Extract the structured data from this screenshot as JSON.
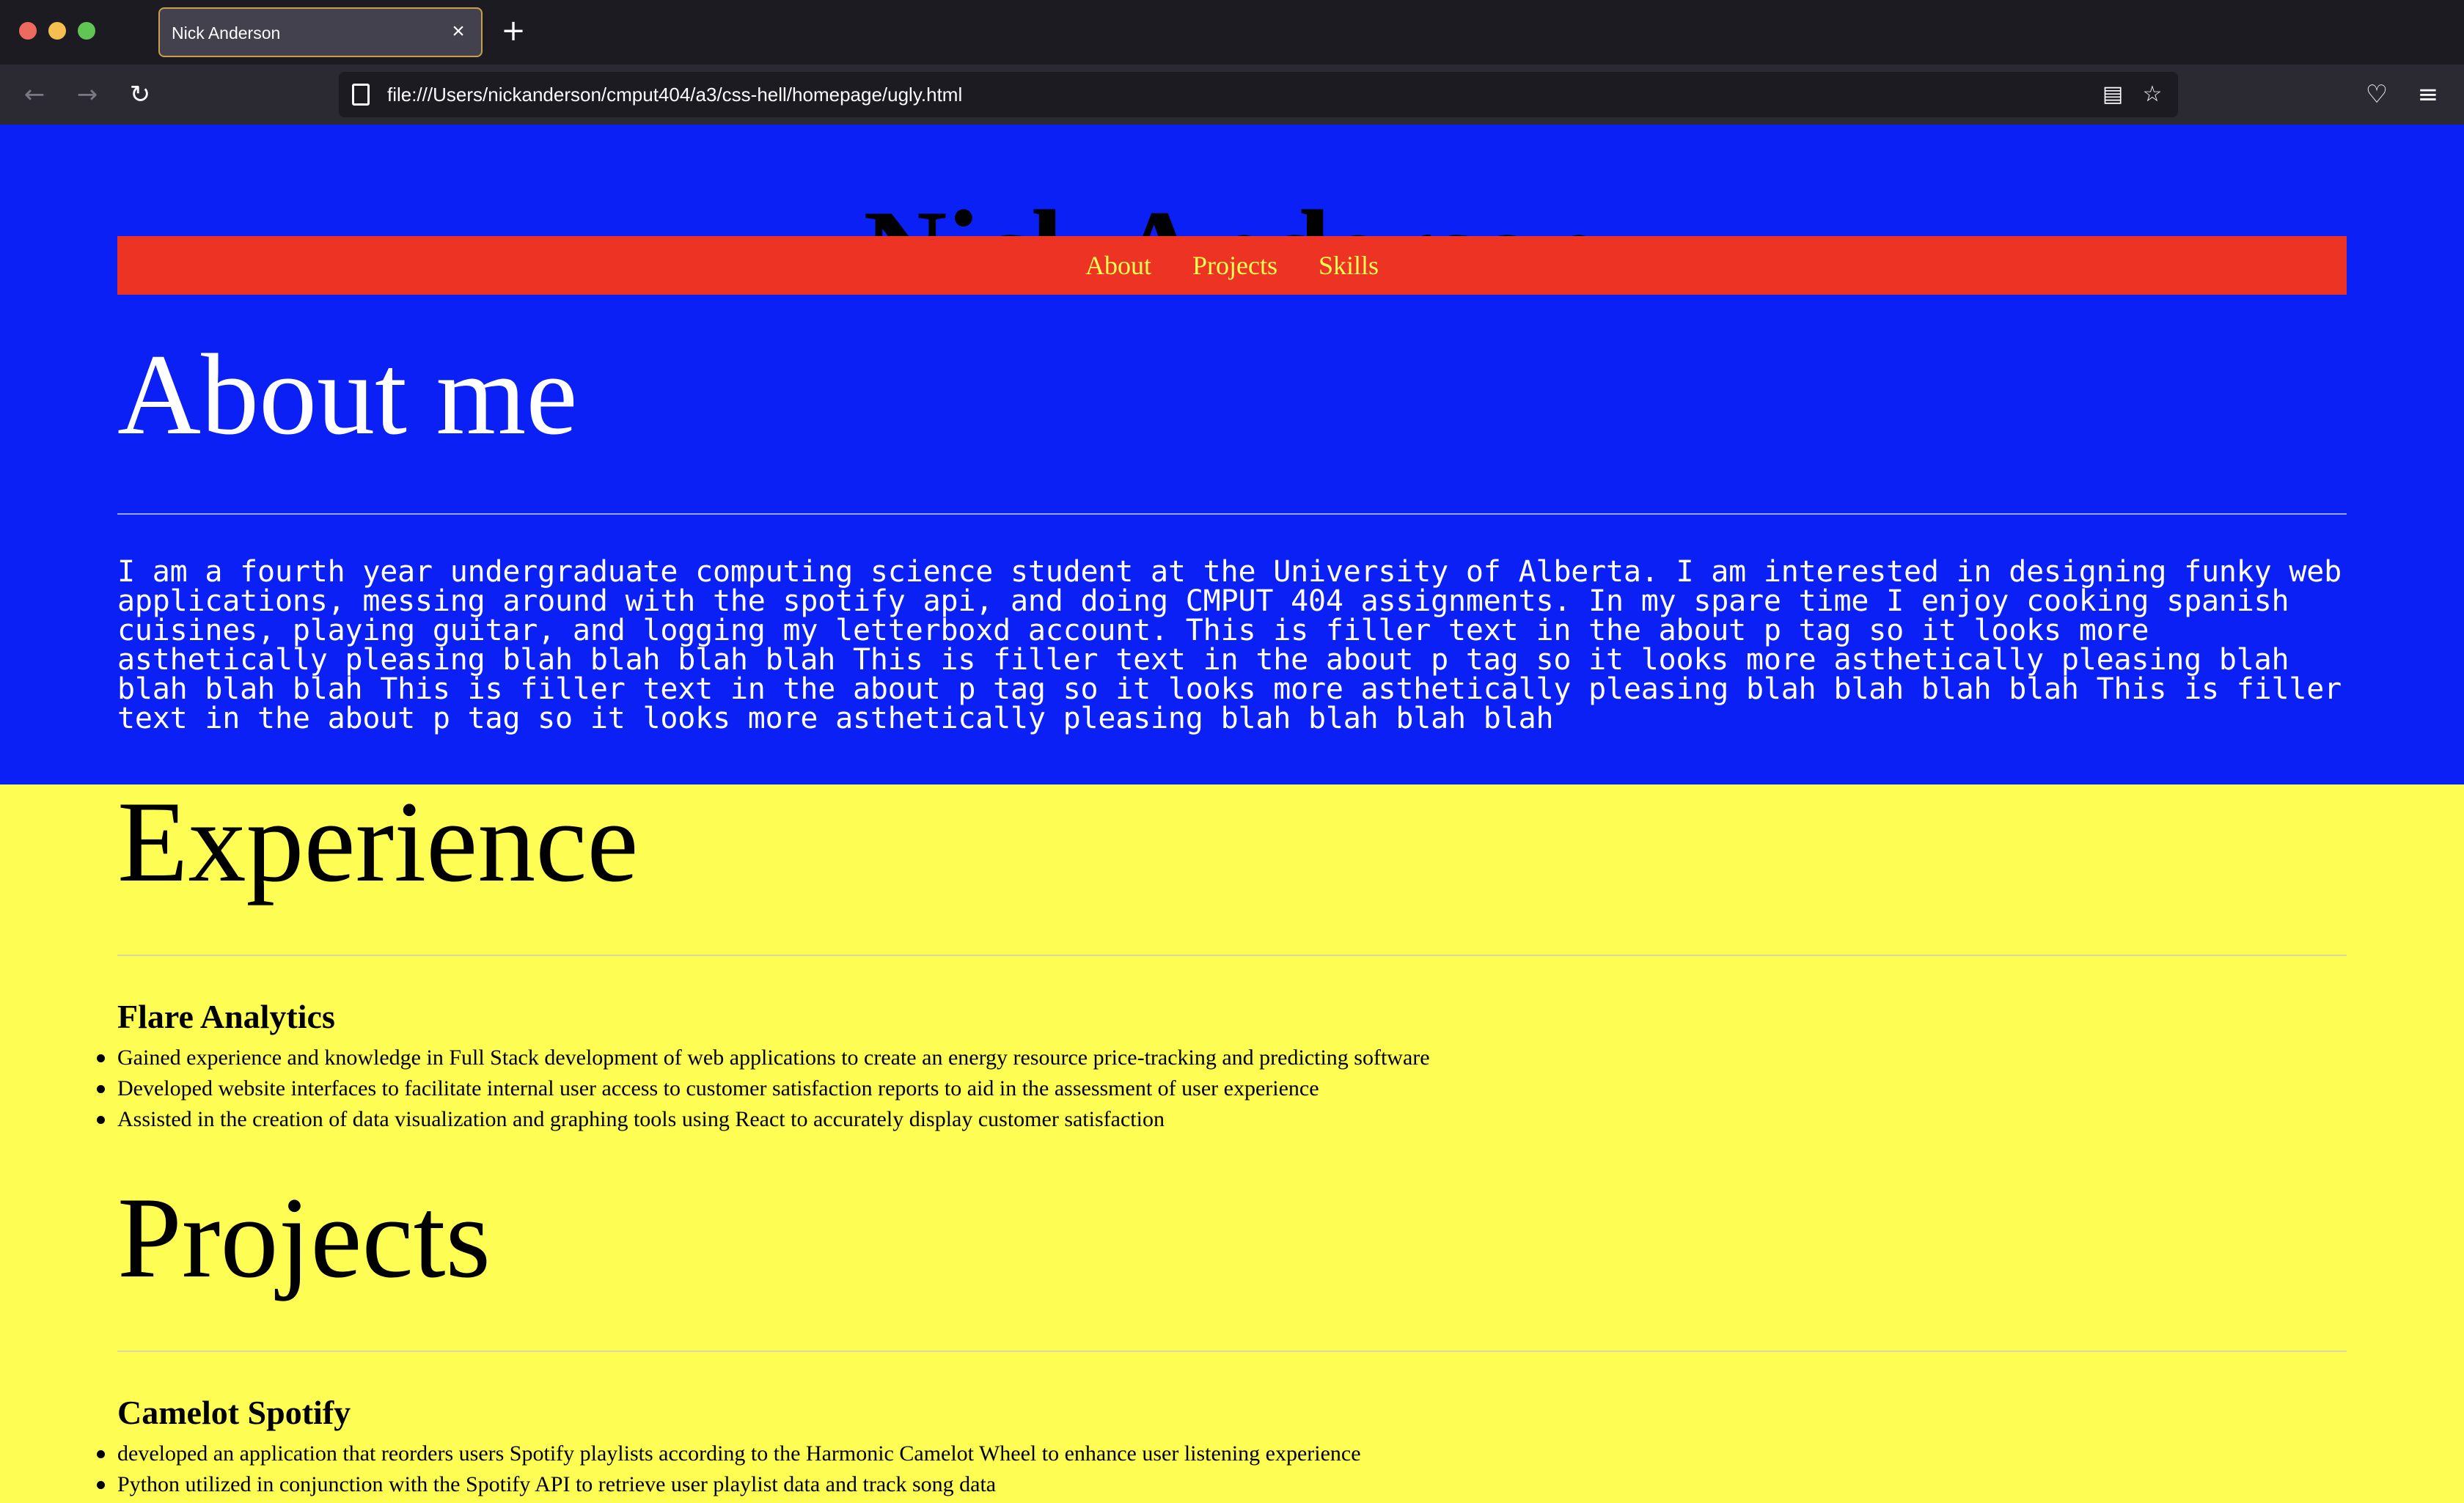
{
  "browser": {
    "tab_title": "Nick Anderson",
    "tab_close": "×",
    "new_tab": "+",
    "back": "←",
    "forward": "→",
    "reload": "↻",
    "url": "file:///Users/nickanderson/cmput404/a3/css-hell/homepage/ugly.html",
    "reader_view": "▤",
    "bookmark": "☆",
    "pocket": "♡",
    "menu": "≡"
  },
  "site": {
    "name": "Nick Anderson",
    "nav": [
      "About",
      "Projects",
      "Skills"
    ]
  },
  "about": {
    "heading": "About me",
    "text": "I am a fourth year undergraduate computing science student at the University of Alberta. I am interested in designing funky web applications, messing around with the spotify api, and doing CMPUT 404 assignments. In my spare time I enjoy cooking spanish cuisines, playing guitar, and logging my letterboxd account. This is filler text in the about p tag so it looks more asthetically pleasing blah blah blah blah This is filler text in the about p tag so it looks more asthetically pleasing blah blah blah blah This is filler text in the about p tag so it looks more asthetically pleasing blah blah blah blah This is filler text in the about p tag so it looks more asthetically pleasing blah blah blah blah"
  },
  "experience": {
    "heading": "Experience",
    "items": [
      {
        "title": "Flare Analytics",
        "bullets": [
          "Gained experience and knowledge in Full Stack development of web applications to create an energy resource price-tracking and predicting software",
          "Developed website interfaces to facilitate internal user access to customer satisfaction reports to aid in the assessment of user experience",
          "Assisted in the creation of data visualization and graphing tools using React to accurately display customer satisfaction"
        ]
      }
    ]
  },
  "projects": {
    "heading": "Projects",
    "items": [
      {
        "title": "Camelot Spotify",
        "bullets": [
          "developed an application that reorders users Spotify playlists according to the Harmonic Camelot Wheel to enhance user listening experience",
          "Python utilized in conjunction with the Spotify API to retrieve user playlist data and track song data"
        ]
      }
    ]
  }
}
